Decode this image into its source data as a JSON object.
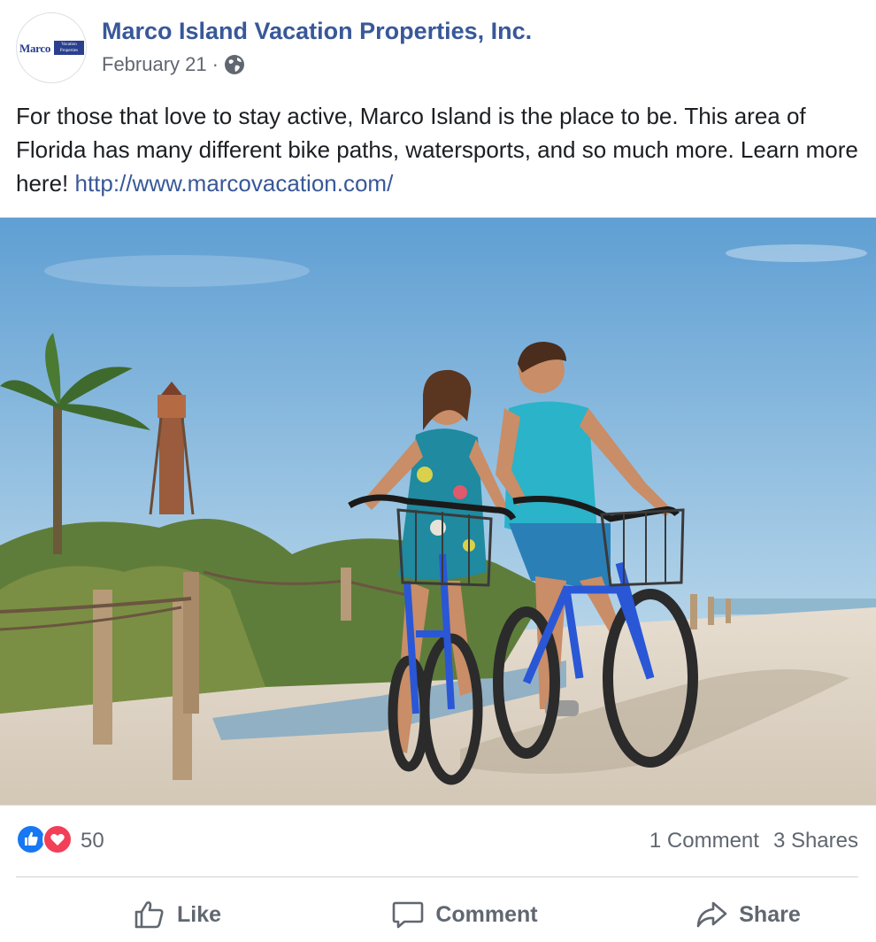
{
  "post": {
    "page_name": "Marco Island Vacation Properties, Inc.",
    "date": "February 21",
    "separator": "·",
    "privacy_icon": "globe-icon",
    "text": "For those that love to stay active, Marco Island is the place to be. This area of Florida has many different bike paths, watersports, and so much more. Learn more here!",
    "link": "http://www.marcovacation.com/",
    "avatar": {
      "logo_left": "Marco",
      "logo_right": "Vacation Properties"
    }
  },
  "photo": {
    "description": "Couple riding blue beach cruiser bicycles on a sandy path near a lighthouse"
  },
  "reactions": {
    "icons": [
      "like-reaction-icon",
      "love-reaction-icon"
    ],
    "count": "50",
    "comments": "1 Comment",
    "shares": "3 Shares"
  },
  "actions": {
    "like": "Like",
    "comment": "Comment",
    "share": "Share"
  },
  "colors": {
    "link": "#385898",
    "meta": "#606770",
    "like_blue": "#1877f2",
    "love_red": "#f33e58"
  }
}
